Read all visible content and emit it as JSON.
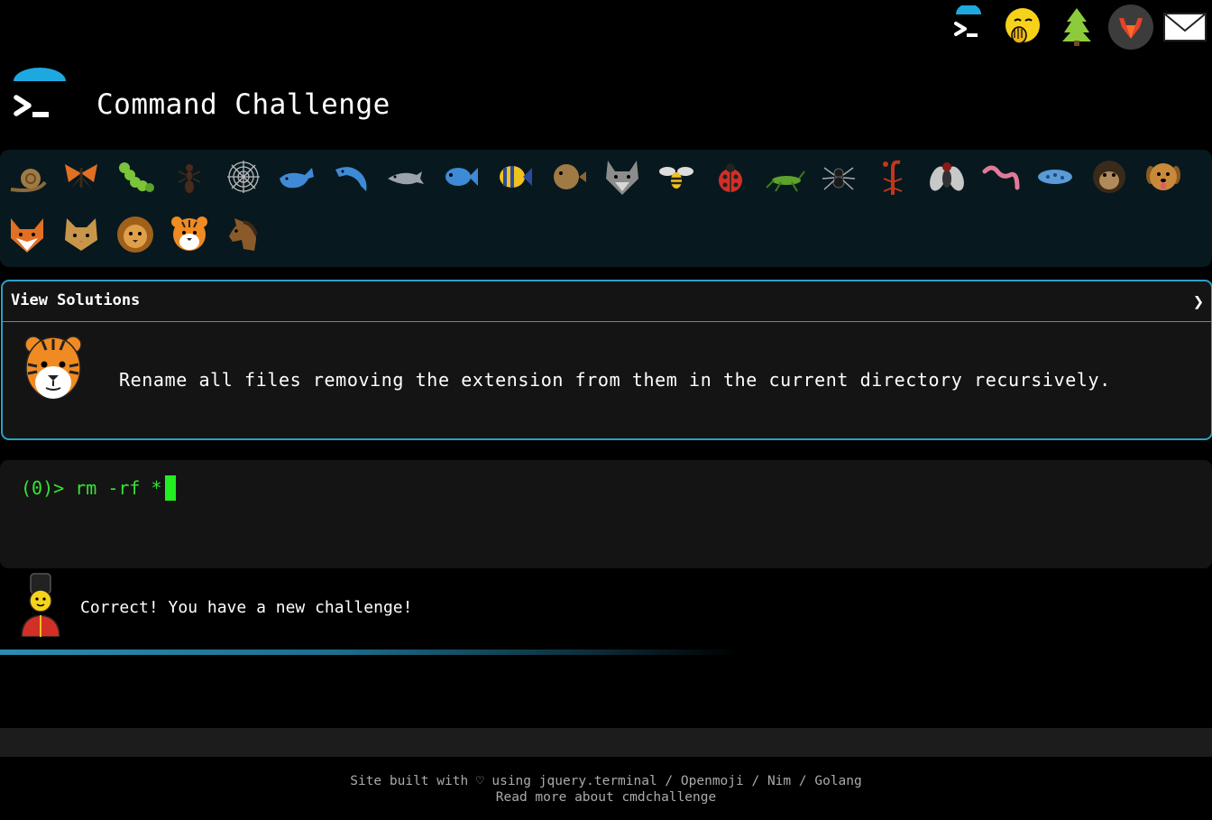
{
  "nav": {
    "icons": [
      "terminal-icon",
      "face-with-hand-over-mouth-icon",
      "evergreen-tree-icon",
      "gitlab-icon",
      "envelope-icon"
    ]
  },
  "header": {
    "title": "Command Challenge",
    "logo_icon": "terminal-icon"
  },
  "challenges": {
    "items": [
      {
        "icon": "snail"
      },
      {
        "icon": "butterfly"
      },
      {
        "icon": "caterpillar"
      },
      {
        "icon": "ant"
      },
      {
        "icon": "spider-web"
      },
      {
        "icon": "whale"
      },
      {
        "icon": "dolphin"
      },
      {
        "icon": "dolphin-gray"
      },
      {
        "icon": "fish"
      },
      {
        "icon": "tropical-fish"
      },
      {
        "icon": "blowfish"
      },
      {
        "icon": "wolf"
      },
      {
        "icon": "honeybee"
      },
      {
        "icon": "lady-beetle"
      },
      {
        "icon": "cricket"
      },
      {
        "icon": "spider"
      },
      {
        "icon": "scorpion"
      },
      {
        "icon": "fly"
      },
      {
        "icon": "worm"
      },
      {
        "icon": "microbe"
      },
      {
        "icon": "chimpanzee"
      },
      {
        "icon": "dog"
      },
      {
        "icon": "fox"
      },
      {
        "icon": "cat"
      },
      {
        "icon": "lion"
      },
      {
        "icon": "tiger"
      },
      {
        "icon": "horse"
      }
    ],
    "current": "tiger"
  },
  "solutions": {
    "title": "View Solutions",
    "toggle": "❯",
    "description": "Rename all files removing the extension from them in the current directory recursively.",
    "icon": "tiger-face-icon"
  },
  "terminal": {
    "prompt": "(0)>",
    "input": " rm -rf *"
  },
  "feedback": {
    "text": "Correct! You have a new challenge!",
    "icon": "guard-icon"
  },
  "footer": {
    "built_prefix": "Site built with ♡ using ",
    "links": [
      "jquery.terminal",
      "Openmoji",
      "Nim",
      "Golang"
    ],
    "separator": " / ",
    "read_more": "Read more about cmdchallenge"
  },
  "colors": {
    "accent": "#2aa0c5",
    "terminal_text": "#33e633",
    "panel_bg": "#07191f"
  }
}
